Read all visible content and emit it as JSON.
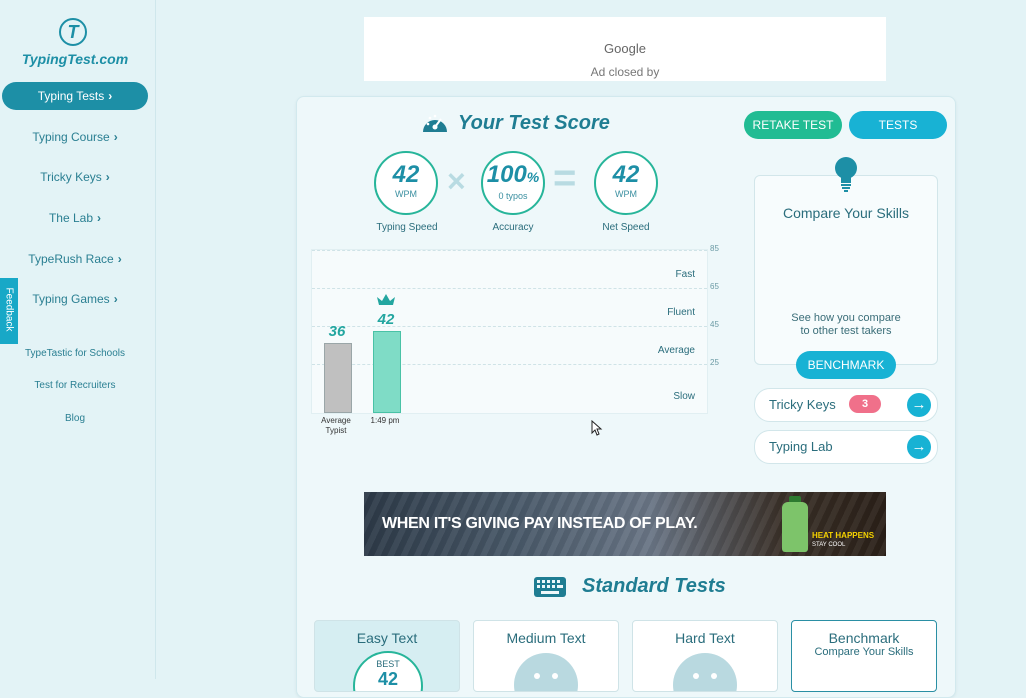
{
  "brand": {
    "logo_letter": "T",
    "name": "TypingTest.com"
  },
  "sidebar": {
    "items": [
      {
        "label": "Typing Tests",
        "active": true
      },
      {
        "label": "Typing Course"
      },
      {
        "label": "Tricky Keys"
      },
      {
        "label": "The Lab"
      },
      {
        "label": "TypeRush Race"
      },
      {
        "label": "Typing Games"
      }
    ],
    "links": [
      "TypeTastic for Schools",
      "Test for Recruiters",
      "Blog"
    ],
    "chevron": "›"
  },
  "feedback": {
    "label": "Feedback"
  },
  "ad_top": {
    "prefix": "Ad closed by",
    "brand": "Google"
  },
  "score": {
    "title": "Your Test Score",
    "retake_label": "RETAKE TEST",
    "tests_label": "TESTS",
    "typing_speed": {
      "value": "42",
      "unit": "WPM",
      "label": "Typing Speed"
    },
    "accuracy": {
      "value": "100",
      "unit": "%",
      "sub": "0 typos",
      "label": "Accuracy"
    },
    "net_speed": {
      "value": "42",
      "unit": "WPM",
      "label": "Net Speed"
    },
    "times_symbol": "×",
    "equals_symbol": "="
  },
  "chart_data": {
    "type": "bar",
    "categories": [
      "Average Typist",
      "1:49 pm"
    ],
    "values": [
      36,
      42
    ],
    "ylim": [
      0,
      85
    ],
    "yticks": [
      25,
      45,
      65,
      85
    ],
    "bands": [
      "Fast",
      "Fluent",
      "Average",
      "Slow"
    ],
    "colors": {
      "average": "#c0c0c0",
      "you": "#7fdcc6"
    },
    "crown_on": "1:49 pm"
  },
  "compare": {
    "title": "Compare Your Skills",
    "sub_line1": "See how you compare",
    "sub_line2": "to other test takers",
    "button": "BENCHMARK"
  },
  "pills": [
    {
      "label": "Tricky Keys",
      "badge": "3"
    },
    {
      "label": "Typing Lab"
    }
  ],
  "banner": {
    "text": "WHEN IT'S GIVING PAY INSTEAD OF PLAY.",
    "tag_line1": "HEAT HAPPENS",
    "tag_line2": "STAY COOL"
  },
  "standard": {
    "title": "Standard Tests",
    "tests": [
      {
        "name": "Easy Text",
        "selected": true,
        "best_label": "BEST",
        "best_value": "42"
      },
      {
        "name": "Medium Text"
      },
      {
        "name": "Hard Text"
      },
      {
        "name": "Benchmark",
        "sub": "Compare Your Skills"
      }
    ]
  },
  "colors": {
    "accent": "#1d8fa6",
    "green": "#21bc93",
    "cyan": "#18b2d4",
    "badge": "#f0708a"
  }
}
